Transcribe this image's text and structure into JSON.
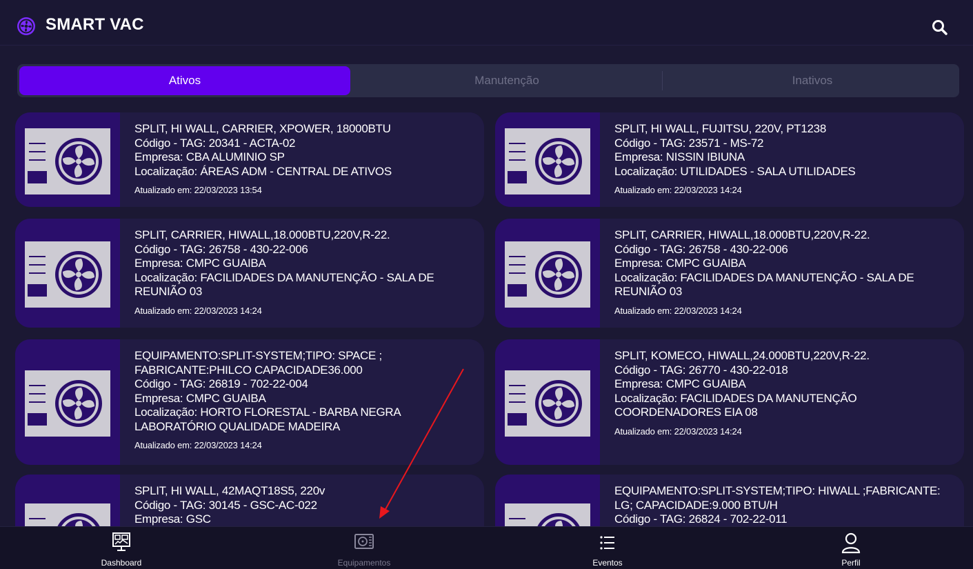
{
  "header": {
    "title": "SMART VAC",
    "logo_icon": "vac-logo-icon",
    "search_icon": "search-icon"
  },
  "tabs": [
    {
      "label": "Ativos",
      "active": true
    },
    {
      "label": "Manutenção",
      "active": false
    },
    {
      "label": "Inativos",
      "active": false
    }
  ],
  "cards": [
    {
      "lines": [
        "SPLIT, HI WALL, CARRIER, XPOWER, 18000BTU",
        "Código - TAG: 20341 - ACTA-02",
        "Empresa: CBA ALUMINIO SP",
        "Localização: ÁREAS ADM - CENTRAL DE ATIVOS"
      ],
      "updated": "Atualizado em: 22/03/2023 13:54"
    },
    {
      "lines": [
        "SPLIT, HI WALL, FUJITSU, 220V, PT1238",
        "Código - TAG: 23571 - MS-72",
        "Empresa: NISSIN IBIUNA",
        "Localização: UTILIDADES - SALA UTILIDADES"
      ],
      "updated": "Atualizado em: 22/03/2023 14:24"
    },
    {
      "lines": [
        "SPLIT, CARRIER, HIWALL,18.000BTU,220V,R-22.",
        "Código - TAG: 26758 - 430-22-006",
        "Empresa: CMPC  GUAIBA",
        "Localização: FACILIDADES DA MANUTENÇÃO - SALA DE",
        "REUNIÃO 03"
      ],
      "updated": "Atualizado em: 22/03/2023 14:24"
    },
    {
      "lines": [
        "SPLIT, CARRIER, HIWALL,18.000BTU,220V,R-22.",
        "Código - TAG: 26758 - 430-22-006",
        "Empresa: CMPC  GUAIBA",
        "Localização: FACILIDADES DA MANUTENÇÃO - SALA DE",
        "REUNIÃO 03"
      ],
      "updated": "Atualizado em: 22/03/2023 14:24"
    },
    {
      "lines": [
        "EQUIPAMENTO:SPLIT-SYSTEM;TIPO: SPACE ;",
        "FABRICANTE:PHILCO CAPACIDADE36.000",
        "Código - TAG: 26819 - 702-22-004",
        "Empresa: CMPC  GUAIBA",
        "Localização: HORTO FLORESTAL - BARBA NEGRA",
        "LABORATÓRIO QUALIDADE MADEIRA"
      ],
      "updated": "Atualizado em: 22/03/2023 14:24"
    },
    {
      "lines": [
        "SPLIT, KOMECO, HIWALL,24.000BTU,220V,R-22.",
        "Código - TAG: 26770 - 430-22-018",
        "Empresa: CMPC  GUAIBA",
        "Localização: FACILIDADES DA MANUTENÇÃO",
        "COORDENADORES EIA 08"
      ],
      "updated": "Atualizado em: 22/03/2023 14:24"
    },
    {
      "lines": [
        "SPLIT, HI WALL, 42MAQT18S5, 220v",
        "Código - TAG: 30145 - GSC-AC-022",
        "Empresa: GSC"
      ],
      "updated": ""
    },
    {
      "lines": [
        "EQUIPAMENTO:SPLIT-SYSTEM;TIPO: HIWALL ;FABRICANTE:",
        "LG; CAPACIDADE:9.000 BTU/H",
        "Código - TAG: 26824 - 702-22-011"
      ],
      "updated": ""
    }
  ],
  "card_icon": "air-conditioner-icon",
  "nav": [
    {
      "label": "Dashboard",
      "icon": "dashboard-icon",
      "active": true
    },
    {
      "label": "Equipamentos",
      "icon": "equipment-icon",
      "active": false
    },
    {
      "label": "Eventos",
      "icon": "list-icon",
      "active": true
    },
    {
      "label": "Perfil",
      "icon": "user-icon",
      "active": true
    }
  ],
  "colors": {
    "accent": "#6200ee",
    "background": "#1b1833",
    "card": "#211b43",
    "card_icon_bg": "#2a0e6b",
    "annotation_arrow": "#e8171d"
  }
}
